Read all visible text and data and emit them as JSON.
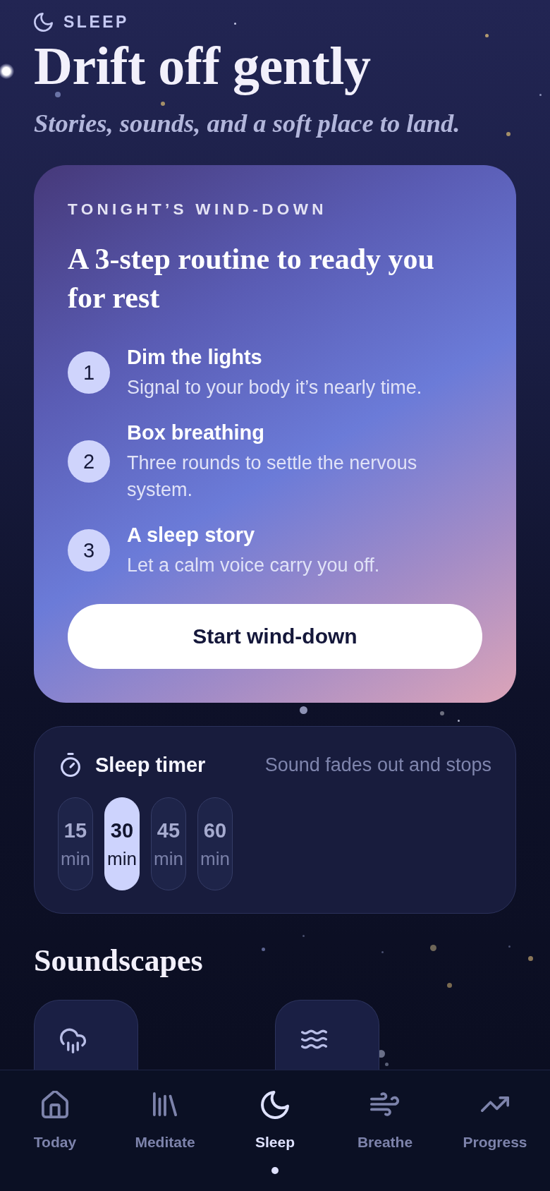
{
  "header": {
    "eyebrow": "SLEEP",
    "title": "Drift off gently",
    "subtitle": "Stories, sounds, and a soft place to land."
  },
  "wind_down": {
    "eyebrow": "TONIGHT’S WIND-DOWN",
    "heading": "A 3-step routine to ready you for rest",
    "steps": [
      {
        "number": "1",
        "title": "Dim the lights",
        "description": "Signal to your body it’s nearly time."
      },
      {
        "number": "2",
        "title": "Box breathing",
        "description": "Three rounds to settle the nervous system."
      },
      {
        "number": "3",
        "title": "A sleep story",
        "description": "Let a calm voice carry you off."
      }
    ],
    "button": "Start wind-down"
  },
  "sleep_timer": {
    "title": "Sleep timer",
    "note": "Sound fades out and stops",
    "options": [
      {
        "value": "15",
        "unit": "min",
        "selected": false
      },
      {
        "value": "30",
        "unit": "min",
        "selected": true
      },
      {
        "value": "45",
        "unit": "min",
        "selected": false
      },
      {
        "value": "60",
        "unit": "min",
        "selected": false
      }
    ]
  },
  "soundscapes": {
    "title": "Soundscapes",
    "items": [
      {
        "kind": "rain"
      },
      {
        "kind": "waves"
      }
    ]
  },
  "nav": [
    {
      "label": "Today",
      "kind": "home",
      "selected": false
    },
    {
      "label": "Meditate",
      "kind": "library",
      "selected": false
    },
    {
      "label": "Sleep",
      "kind": "moon",
      "selected": true
    },
    {
      "label": "Breathe",
      "kind": "wind",
      "selected": false
    },
    {
      "label": "Progress",
      "kind": "trend",
      "selected": false
    }
  ]
}
